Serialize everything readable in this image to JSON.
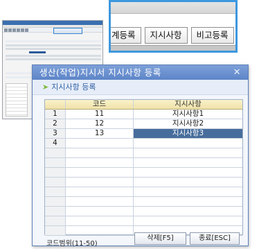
{
  "zoom": {
    "buttons": [
      "계등록",
      "지시사항",
      "비고등록"
    ]
  },
  "dialog": {
    "title": "생산(작업)지시서 지시사항 등록",
    "close_glyph": "✕",
    "section_title": "지시사항 등록",
    "grid": {
      "headers": {
        "no": "",
        "code": "코드",
        "desc": "지시사항"
      },
      "rows": [
        {
          "no": "1",
          "code": "11",
          "desc": "지시사항1",
          "selected": false
        },
        {
          "no": "2",
          "code": "12",
          "desc": "지시사항2",
          "selected": false
        },
        {
          "no": "3",
          "code": "13",
          "desc": "지시사항3",
          "selected": true
        },
        {
          "no": "4",
          "code": "",
          "desc": "",
          "selected": false
        },
        {
          "no": "",
          "code": "",
          "desc": "",
          "selected": false
        },
        {
          "no": "",
          "code": "",
          "desc": "",
          "selected": false
        },
        {
          "no": "",
          "code": "",
          "desc": "",
          "selected": false
        },
        {
          "no": "",
          "code": "",
          "desc": "",
          "selected": false
        },
        {
          "no": "",
          "code": "",
          "desc": "",
          "selected": false
        },
        {
          "no": "",
          "code": "",
          "desc": "",
          "selected": false
        },
        {
          "no": "",
          "code": "",
          "desc": "",
          "selected": false
        },
        {
          "no": "",
          "code": "",
          "desc": "",
          "selected": false
        },
        {
          "no": "",
          "code": "",
          "desc": "",
          "selected": false
        }
      ]
    },
    "range_label": "코드범위(11-50)",
    "delete_button": "삭제[F5]",
    "exit_button": "종료[ESC]"
  },
  "colors": {
    "title_bar": "#5d85c8",
    "selection": "#476d9c",
    "zoom_border": "#3d98de",
    "header_fill": "#efe1a8"
  }
}
